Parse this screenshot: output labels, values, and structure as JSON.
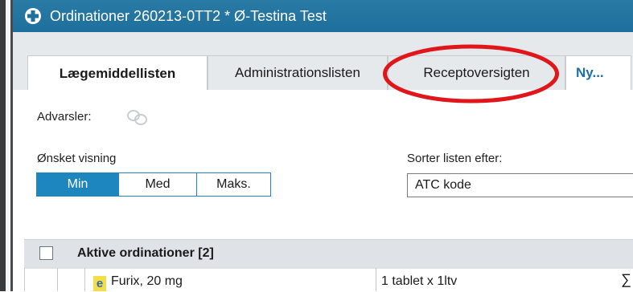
{
  "window": {
    "title": "Ordinationer 260213-0TT2 * Ø-Testina Test"
  },
  "tabs": [
    {
      "label": "Lægemiddellisten",
      "active": true
    },
    {
      "label": "Administrationslisten",
      "active": false
    },
    {
      "label": "Receptoversigten",
      "active": false
    },
    {
      "label": "Ny...",
      "active": false
    }
  ],
  "warnings": {
    "label": "Advarsler:"
  },
  "view": {
    "label": "Ønsket visning",
    "options": [
      "Min",
      "Med",
      "Maks."
    ],
    "selected": "Min"
  },
  "sort": {
    "label": "Sorter listen efter:",
    "value": "ATC kode"
  },
  "section": {
    "title": "Aktive ordinationer [2]"
  },
  "rows": [
    {
      "name": "Furix, 20 mg",
      "dose": "1 tablet x 1ltv",
      "extra": "∑"
    }
  ],
  "colors": {
    "title_bar": "#1f6f9c",
    "accent": "#1d86bf",
    "highlight_ring": "#e0161b"
  }
}
